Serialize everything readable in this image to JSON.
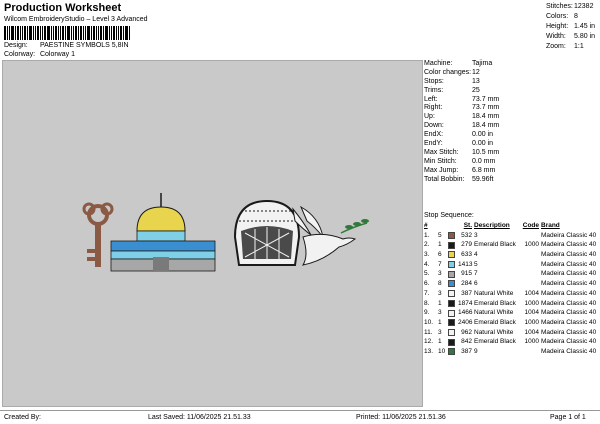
{
  "header": {
    "title": "Production Worksheet",
    "subtitle": "Wilcom EmbroideryStudio – Level 3 Advanced",
    "design_label": "Design:",
    "design_value": "PAESTINE SYMBOLS 5,8IN",
    "colorway_label": "Colorway:",
    "colorway_value": "Colorway 1"
  },
  "stats": [
    {
      "k": "Stitches:",
      "v": "12382"
    },
    {
      "k": "Colors:",
      "v": "8"
    },
    {
      "k": "Height:",
      "v": "1.45 in"
    },
    {
      "k": "Width:",
      "v": "5.80 in"
    },
    {
      "k": "Zoom:",
      "v": "1:1"
    }
  ],
  "info": [
    {
      "k": "Machine:",
      "v": "Tajima"
    },
    {
      "k": "Color changes:",
      "v": "12"
    },
    {
      "k": "Stops:",
      "v": "13"
    },
    {
      "k": "Trims:",
      "v": "25"
    },
    {
      "k": "Left:",
      "v": "73.7 mm"
    },
    {
      "k": "Right:",
      "v": "73.7 mm"
    },
    {
      "k": "Up:",
      "v": "18.4 mm"
    },
    {
      "k": "Down:",
      "v": "18.4 mm"
    },
    {
      "k": "EndX:",
      "v": "0.00 in"
    },
    {
      "k": "EndY:",
      "v": "0.00 in"
    },
    {
      "k": "Max Stitch:",
      "v": "10.5 mm"
    },
    {
      "k": "Min Stitch:",
      "v": "0.0 mm"
    },
    {
      "k": "Max Jump:",
      "v": "6.8 mm"
    },
    {
      "k": "Total Bobbin:",
      "v": "59.96ft"
    }
  ],
  "stops_title": "Stop Sequence:",
  "stops_headers": {
    "num": "#",
    "stop": "",
    "st": "St.",
    "desc": "Description",
    "code": "Code",
    "brand": "Brand"
  },
  "stops": [
    {
      "num": "1.",
      "stop": "5",
      "color": "#8b5a45",
      "st": "532",
      "desc": "3",
      "code": "",
      "brand": "Madeira Classic 40"
    },
    {
      "num": "2.",
      "stop": "1",
      "color": "#1a1a1a",
      "st": "279",
      "desc": "Emerald Black",
      "code": "1000",
      "brand": "Madeira Classic 40"
    },
    {
      "num": "3.",
      "stop": "6",
      "color": "#e8d44d",
      "st": "633",
      "desc": "4",
      "code": "",
      "brand": "Madeira Classic 40"
    },
    {
      "num": "4.",
      "stop": "7",
      "color": "#7fd0e6",
      "st": "1413",
      "desc": "5",
      "code": "",
      "brand": "Madeira Classic 40"
    },
    {
      "num": "5.",
      "stop": "3",
      "color": "#a7a7a7",
      "st": "915",
      "desc": "7",
      "code": "",
      "brand": "Madeira Classic 40"
    },
    {
      "num": "6.",
      "stop": "8",
      "color": "#3a8fd1",
      "st": "284",
      "desc": "6",
      "code": "",
      "brand": "Madeira Classic 40"
    },
    {
      "num": "7.",
      "stop": "3",
      "color": "#f2f2f2",
      "st": "387",
      "desc": "Natural White",
      "code": "1004",
      "brand": "Madeira Classic 40"
    },
    {
      "num": "8.",
      "stop": "1",
      "color": "#1a1a1a",
      "st": "1874",
      "desc": "Emerald Black",
      "code": "1000",
      "brand": "Madeira Classic 40"
    },
    {
      "num": "9.",
      "stop": "3",
      "color": "#f2f2f2",
      "st": "1466",
      "desc": "Natural White",
      "code": "1004",
      "brand": "Madeira Classic 40"
    },
    {
      "num": "10.",
      "stop": "1",
      "color": "#1a1a1a",
      "st": "2406",
      "desc": "Emerald Black",
      "code": "1000",
      "brand": "Madeira Classic 40"
    },
    {
      "num": "11.",
      "stop": "3",
      "color": "#f2f2f2",
      "st": "962",
      "desc": "Natural White",
      "code": "1004",
      "brand": "Madeira Classic 40"
    },
    {
      "num": "12.",
      "stop": "1",
      "color": "#1a1a1a",
      "st": "842",
      "desc": "Emerald Black",
      "code": "1000",
      "brand": "Madeira Classic 40"
    },
    {
      "num": "13.",
      "stop": "10",
      "color": "#2f7a3a",
      "st": "387",
      "desc": "9",
      "code": "",
      "brand": "Madeira Classic 40"
    }
  ],
  "footer": {
    "created_by": "Created By:",
    "last_saved": "Last Saved: 11/06/2025 21.51.33",
    "printed": "Printed: 11/06/2025 21.51.36",
    "page": "Page 1 of 1"
  },
  "colors": {
    "canvas_bg": "#c9c9c9",
    "key": "#8b5a45",
    "dome": "#e8d44d",
    "tile": "#7fd0e6",
    "blue": "#3a8fd1",
    "black": "#1a1a1a",
    "white": "#f2f2f2",
    "green": "#2f7a3a"
  }
}
